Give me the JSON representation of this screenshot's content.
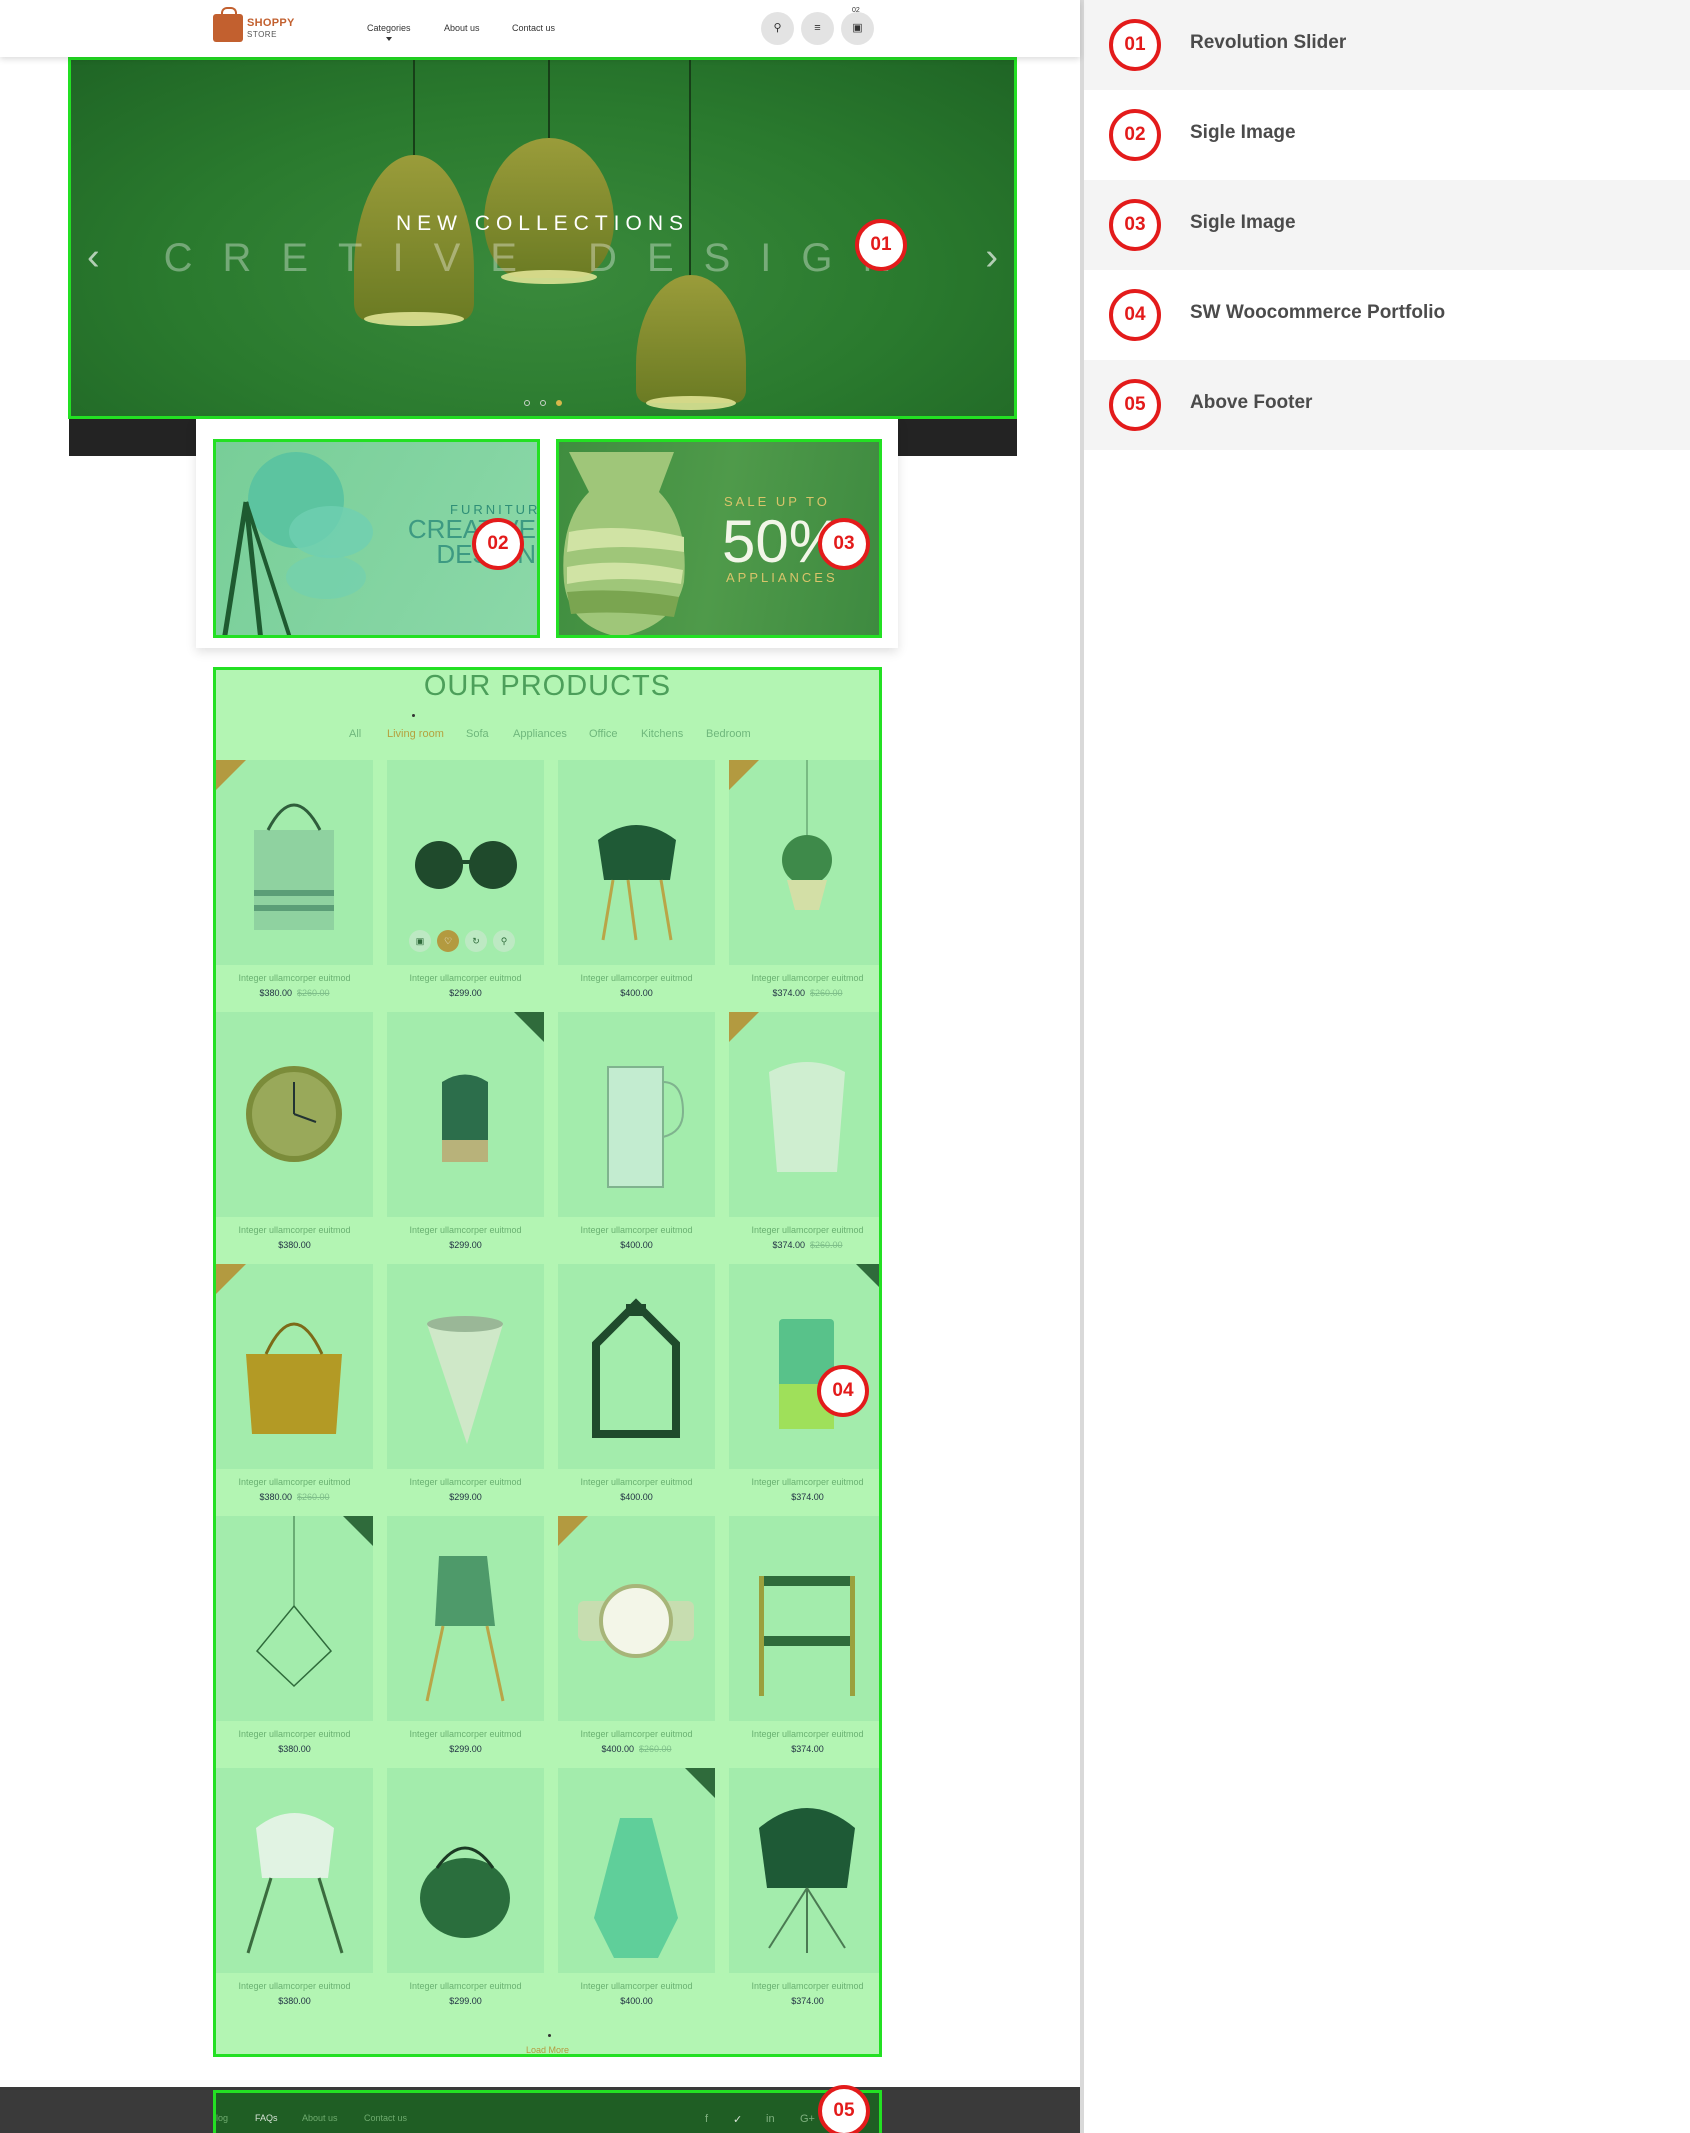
{
  "header": {
    "logo_name": "SHOPPY",
    "logo_sub": "STORE",
    "nav": [
      "Categories",
      "About us",
      "Contact us"
    ],
    "cart_count": "02",
    "icons": [
      "search-icon",
      "menu-icon",
      "cart-icon"
    ]
  },
  "slider": {
    "subtitle": "NEW COLLECTIONS",
    "title": "CRETIVE DESIGN",
    "prev_icon": "chevron-left-icon",
    "next_icon": "chevron-right-icon",
    "slides": 3,
    "active_slide": 3
  },
  "banners": [
    {
      "small": "FURNITURE",
      "big": "CREATIVE DESIGN"
    },
    {
      "small_top": "SALE UP TO",
      "big": "50%",
      "small_bottom": "APPLIANCES"
    }
  ],
  "products": {
    "title": "OUR PRODUCTS",
    "tabs": [
      "All",
      "Living room",
      "Sofa",
      "Appliances",
      "Office",
      "Kitchens",
      "Bedroom"
    ],
    "active_tab": "Living room",
    "items": [
      {
        "name": "Integer ullamcorper euitmod",
        "price": "$380.00",
        "old": "$260.00",
        "badge": "left",
        "img": "tote-bag"
      },
      {
        "name": "Integer ullamcorper euitmod",
        "price": "$299.00",
        "old": "",
        "badge": "",
        "img": "sunglasses"
      },
      {
        "name": "Integer ullamcorper euitmod",
        "price": "$400.00",
        "old": "",
        "badge": "",
        "img": "chair-eames"
      },
      {
        "name": "Integer ullamcorper euitmod",
        "price": "$374.00",
        "old": "$260.00",
        "badge": "left",
        "img": "hanging-plant"
      },
      {
        "name": "Integer ullamcorper euitmod",
        "price": "$380.00",
        "old": "",
        "badge": "",
        "img": "wall-clock"
      },
      {
        "name": "Integer ullamcorper euitmod",
        "price": "$299.00",
        "old": "",
        "badge": "right",
        "img": "vase"
      },
      {
        "name": "Integer ullamcorper euitmod",
        "price": "$400.00",
        "old": "",
        "badge": "",
        "img": "pitcher"
      },
      {
        "name": "Integer ullamcorper euitmod",
        "price": "$374.00",
        "old": "$260.00",
        "badge": "left",
        "img": "paper-bag"
      },
      {
        "name": "Integer ullamcorper euitmod",
        "price": "$380.00",
        "old": "$260.00",
        "badge": "left",
        "img": "leather-bag"
      },
      {
        "name": "Integer ullamcorper euitmod",
        "price": "$299.00",
        "old": "",
        "badge": "",
        "img": "cone-vase"
      },
      {
        "name": "Integer ullamcorper euitmod",
        "price": "$400.00",
        "old": "",
        "badge": "",
        "img": "lantern"
      },
      {
        "name": "Integer ullamcorper euitmod",
        "price": "$374.00",
        "old": "",
        "badge": "right",
        "img": "glass"
      },
      {
        "name": "Integer ullamcorper euitmod",
        "price": "$380.00",
        "old": "",
        "badge": "right",
        "img": "pendant"
      },
      {
        "name": "Integer ullamcorper euitmod",
        "price": "$299.00",
        "old": "",
        "badge": "",
        "img": "chair"
      },
      {
        "name": "Integer ullamcorper euitmod",
        "price": "$400.00",
        "old": "$260.00",
        "badge": "left",
        "img": "watch"
      },
      {
        "name": "Integer ullamcorper euitmod",
        "price": "$374.00",
        "old": "",
        "badge": "",
        "img": "trolley"
      },
      {
        "name": "Integer ullamcorper euitmod",
        "price": "$380.00",
        "old": "",
        "badge": "",
        "img": "chair-white"
      },
      {
        "name": "Integer ullamcorper euitmod",
        "price": "$299.00",
        "old": "",
        "badge": "",
        "img": "kettle"
      },
      {
        "name": "Integer ullamcorper euitmod",
        "price": "$400.00",
        "old": "",
        "badge": "right",
        "img": "jug-vase"
      },
      {
        "name": "Integer ullamcorper euitmod",
        "price": "$374.00",
        "old": "",
        "badge": "",
        "img": "lounge-chair"
      }
    ],
    "load_more": "Load More"
  },
  "footer": {
    "links": [
      "Blog",
      "FAQs",
      "About us",
      "Contact us"
    ],
    "social": [
      "facebook-icon",
      "twitter-icon",
      "linkedin-icon",
      "google-plus-icon"
    ]
  },
  "legend": [
    {
      "num": "01",
      "label": "Revolution Slider"
    },
    {
      "num": "02",
      "label": "Sigle Image"
    },
    {
      "num": "03",
      "label": "Sigle Image"
    },
    {
      "num": "04",
      "label": "SW Woocommerce Portfolio"
    },
    {
      "num": "05",
      "label": "Above Footer"
    }
  ],
  "colors": {
    "highlight": "#23e023",
    "marker": "#e31b1b",
    "brand": "#c2602f",
    "accent": "#b39a40"
  }
}
